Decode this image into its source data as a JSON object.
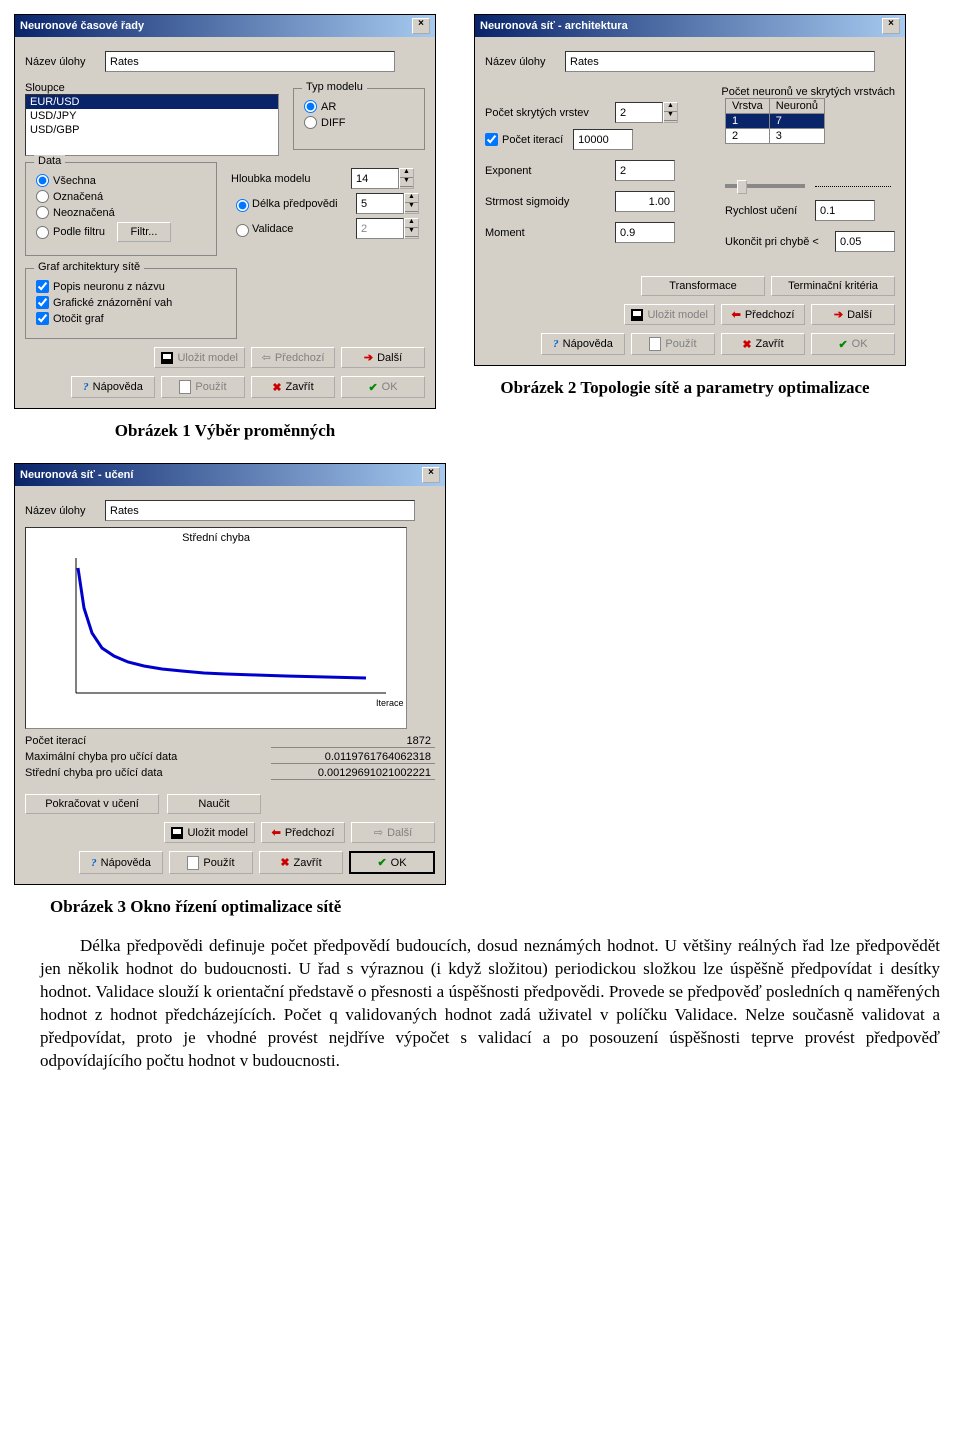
{
  "dlg1": {
    "title": "Neuronové časové řady",
    "task_label": "Název úlohy",
    "task_value": "Rates",
    "columns_label": "Sloupce",
    "columns": [
      "EUR/USD",
      "USD/JPY",
      "USD/GBP"
    ],
    "modeltype": {
      "legend": "Typ modelu",
      "ar": "AR",
      "diff": "DIFF"
    },
    "data": {
      "legend": "Data",
      "all": "Všechna",
      "marked": "Označená",
      "unmarked": "Neoznačená",
      "byfilter": "Podle filtru",
      "filter_btn": "Filtr..."
    },
    "depth_label": "Hloubka modelu",
    "depth": "14",
    "forecast_label": "Délka předpovědi",
    "forecast": "5",
    "validate_label": "Validace",
    "validate": "2",
    "arch": {
      "legend": "Graf architektury sítě",
      "a": "Popis neuronu z názvu",
      "b": "Grafické znázornění vah",
      "c": "Otočit graf"
    },
    "buttons": {
      "save": "Uložit model",
      "prev": "Předchozí",
      "next": "Další",
      "help": "Nápověda",
      "apply": "Použít",
      "close": "Zavřít",
      "ok": "OK"
    }
  },
  "dlg2": {
    "title": "Neuronová síť - architektura",
    "task_label": "Název úlohy",
    "task_value": "Rates",
    "hidden_label": "Počet skrytých vrstev",
    "hidden": "2",
    "neurons_label": "Počet neuronů ve skrytých vrstvách",
    "tbl": {
      "h1": "Vrstva",
      "h2": "Neuronů",
      "rows": [
        [
          "1",
          "7"
        ],
        [
          "2",
          "3"
        ]
      ]
    },
    "iter_label": "Počet iterací",
    "iter": "10000",
    "exp_label": "Exponent",
    "exp": "2",
    "sigm_label": "Strmost sigmoidy",
    "sigm": "1.00",
    "mom_label": "Moment",
    "mom": "0.9",
    "lr_label": "Rychlost učení",
    "lr": "0.1",
    "stop_label": "Ukončit pri chybě <",
    "stop": "0.05",
    "btn_trans": "Transformace",
    "btn_term": "Terminační kritéria",
    "buttons": {
      "save": "Uložit model",
      "prev": "Předchozí",
      "next": "Další",
      "help": "Nápověda",
      "apply": "Použít",
      "close": "Zavřít",
      "ok": "OK"
    }
  },
  "dlg3": {
    "title": "Neuronová síť - učení",
    "task_label": "Název úlohy",
    "task_value": "Rates",
    "chart_title": "Střední chyba",
    "xaxis": "Iterace",
    "iter_label": "Počet iterací",
    "iter": "1872",
    "maxerr_label": "Maximální chyba pro učící data",
    "maxerr": "0.0119761764062318",
    "meanerr_label": "Střední chyba pro učící data",
    "meanerr": "0.00129691021002221",
    "btn_cont": "Pokračovat v učení",
    "btn_learn": "Naučit",
    "buttons": {
      "save": "Uložit model",
      "prev": "Předchozí",
      "next": "Další",
      "help": "Nápověda",
      "apply": "Použít",
      "close": "Zavřít",
      "ok": "OK"
    }
  },
  "captions": {
    "c1": "Obrázek 1 Výběr proměnných",
    "c2": "Obrázek 2 Topologie sítě a parametry optimalizace",
    "c3": "Obrázek 3 Okno řízení optimalizace sítě"
  },
  "paragraph": "Délka předpovědi definuje počet předpovědí budoucích, dosud neznámých hodnot. U většiny reálných řad lze předpovědět jen několik hodnot do budoucnosti. U řad s výraznou (i když složitou) periodickou složkou lze úspěšně předpovídat i desítky hodnot. Validace slouží k orientační představě o přesnosti a úspěšnosti předpovědi. Provede se předpověď posledních q naměřených hodnot z hodnot předcházejících. Počet q validovaných hodnot zadá uživatel v políčku Validace. Nelze současně validovat a předpovídat, proto je vhodné provést nejdříve výpočet s validací a po posouzení úspěšnosti teprve provést předpověď odpovídajícího počtu hodnot v budoucnosti.",
  "chart_data": {
    "type": "line",
    "title": "Střední chyba",
    "xlabel": "Iterace",
    "ylabel": "",
    "x": [
      0,
      100,
      200,
      300,
      400,
      500,
      600,
      700,
      800,
      900,
      1000,
      1200,
      1400,
      1600,
      1872
    ],
    "values": [
      0.025,
      0.012,
      0.008,
      0.006,
      0.005,
      0.0045,
      0.004,
      0.0035,
      0.003,
      0.0028,
      0.0025,
      0.0022,
      0.002,
      0.0018,
      0.0013
    ],
    "ylim": [
      0,
      0.03
    ]
  }
}
